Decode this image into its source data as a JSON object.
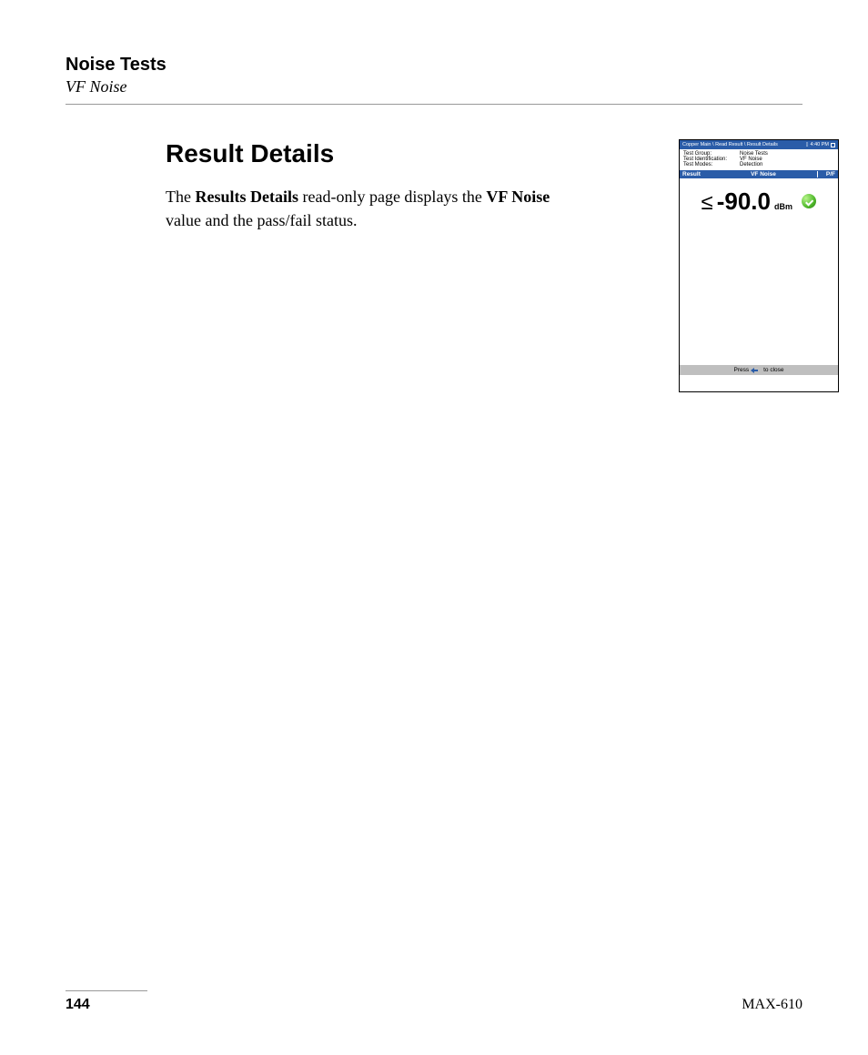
{
  "header": {
    "section_title": "Noise Tests",
    "section_subtitle": "VF Noise"
  },
  "content": {
    "heading": "Result Details",
    "para_pre": "The ",
    "para_b1": "Results Details",
    "para_mid": " read-only page displays the ",
    "para_b2": "VF Noise",
    "para_post": " value and the pass/fail status."
  },
  "screenshot": {
    "titlebar": {
      "breadcrumb": "Copper Main \\ Read Result \\ Result Details",
      "time": "4:40 PM"
    },
    "meta": {
      "rows": [
        {
          "label": "Test Group:",
          "value": "Noise Tests"
        },
        {
          "label": "Test Identification:",
          "value": "VF Noise"
        },
        {
          "label": "Test Modes:",
          "value": "Detection"
        }
      ]
    },
    "resultbar": {
      "left": "Result",
      "mid": "VF Noise",
      "right": "P/F"
    },
    "value": {
      "le": "≤",
      "number": "-90.0",
      "unit": "dBm"
    },
    "footer_pre": "Press",
    "footer_post": "to close"
  },
  "footer": {
    "page_number": "144",
    "model": "MAX-610"
  }
}
